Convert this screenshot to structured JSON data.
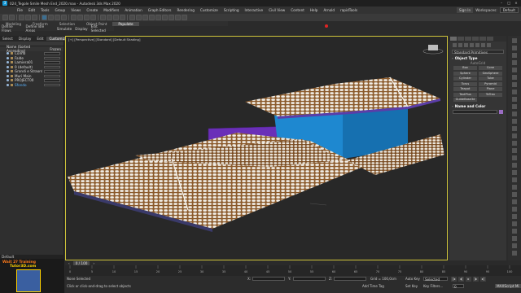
{
  "app": {
    "title": "024_Tegole Smile Mesh End_2020.max - Autodesk 3ds Max 2020",
    "logo_text": "3"
  },
  "menu": {
    "items": [
      "File",
      "Edit",
      "Tools",
      "Group",
      "Views",
      "Create",
      "Modifiers",
      "Animation",
      "Graph Editors",
      "Rendering",
      "Customize",
      "Scripting",
      "Interactive",
      "Civil View",
      "Content",
      "Help",
      "Arnold",
      "rapidTools"
    ],
    "sign_in": "Sign In",
    "workspaces_label": "Workspaces:",
    "workspace_value": "Default"
  },
  "ribbon": {
    "tabs": [
      "Modeling",
      "Freeform",
      "Selection",
      "Object Paint",
      "Populate"
    ],
    "active_tab": "Populate",
    "row_items": [
      "Define Flows",
      "Define Idle Areas",
      "Simulate",
      "Display",
      "Edit Selected"
    ]
  },
  "explorer": {
    "tabs": [
      "Select",
      "Display",
      "Edit",
      "Customize"
    ],
    "active_tab": "Customize",
    "header": "Name (Sorted Ascending)",
    "header_right": "Frozen",
    "rows": [
      {
        "name": "Colmo",
        "selected": false
      },
      {
        "name": "Falde",
        "selected": false
      },
      {
        "name": "Lamiera01",
        "selected": false
      },
      {
        "name": "0 (default)",
        "selected": false
      },
      {
        "name": "Grondi e Straordinari",
        "selected": false
      },
      {
        "name": "Muri Main",
        "selected": false
      },
      {
        "name": "PROJECT00",
        "selected": false
      },
      {
        "name": "Sfondo",
        "selected": true
      }
    ],
    "layer_default": "Default"
  },
  "viewport": {
    "label": "[+] [Perspective] [Standard] [Default Shading]"
  },
  "command_panel": {
    "dropdown": "Standard Primitives",
    "object_type_title": "Object Type",
    "autogrid": "AutoGrid",
    "buttons": [
      "Box",
      "Cone",
      "Sphere",
      "GeoSphere",
      "Cylinder",
      "Tube",
      "Torus",
      "Pyramid",
      "Teapot",
      "Plane",
      "TextPlus",
      "TeTrex",
      "GuideBase3d"
    ],
    "name_color_title": "Name and Color"
  },
  "timeline": {
    "slider": "0 / 100",
    "ticks": [
      "0",
      "5",
      "10",
      "15",
      "20",
      "25",
      "30",
      "35",
      "40",
      "45",
      "50",
      "55",
      "60",
      "65",
      "70",
      "75",
      "80",
      "85",
      "90",
      "95",
      "100"
    ]
  },
  "status": {
    "selection": "None Selected",
    "prompt": "Click or click-and-drag to select objects",
    "x_label": "X:",
    "y_label": "Y:",
    "z_label": "Z:",
    "grid": "Grid = 100,0cm",
    "add_time_tag": "Add Time Tag",
    "auto_key": "Auto Key",
    "set_key": "Set Key",
    "key_filter_value": "Selected",
    "key_filters": "Key Filters...",
    "frame": "0",
    "maxscript": "MAXScript Mi"
  },
  "watermark": {
    "line1": "Wait 2? Training",
    "line2": "Tutor3D.com"
  },
  "colors": {
    "viewport_border": "#cfc43a",
    "house_wall": "#1e88d0",
    "purple_box": "#6a2fb8",
    "roof_tile": "#f2efe8",
    "roof_under": "#8b5a2b",
    "selection_blue": "#5ab4ff"
  }
}
